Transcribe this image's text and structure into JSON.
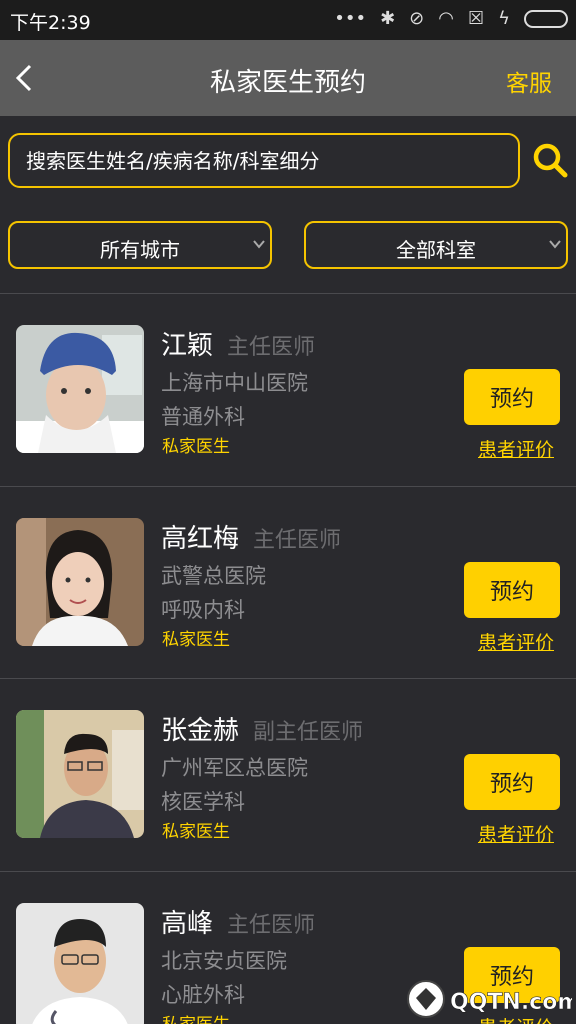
{
  "status_bar": {
    "time": "下午2:39"
  },
  "header": {
    "title": "私家医生预约",
    "service": "客服"
  },
  "search": {
    "placeholder": "搜索医生姓名/疾病名称/科室细分"
  },
  "filters": {
    "city": "所有城市",
    "department": "全部科室"
  },
  "doctors": [
    {
      "name": "江颖",
      "rank": "主任医师",
      "hospital": "上海市中山医院",
      "dept": "普通外科",
      "tag": "私家医生",
      "book": "预约",
      "review": "患者评价"
    },
    {
      "name": "高红梅",
      "rank": "主任医师",
      "hospital": "武警总医院",
      "dept": "呼吸内科",
      "tag": "私家医生",
      "book": "预约",
      "review": "患者评价"
    },
    {
      "name": "张金赫",
      "rank": "副主任医师",
      "hospital": "广州军区总医院",
      "dept": "核医学科",
      "tag": "私家医生",
      "book": "预约",
      "review": "患者评价"
    },
    {
      "name": "高峰",
      "rank": "主任医师",
      "hospital": "北京安贞医院",
      "dept": "心脏外科",
      "tag": "私家医生",
      "book": "预约",
      "review": "患者评价"
    }
  ],
  "watermark": {
    "text": "QQTN.com"
  },
  "colors": {
    "accent": "#ffd400",
    "background": "#2a2a2e",
    "header": "#5c5c5c"
  }
}
